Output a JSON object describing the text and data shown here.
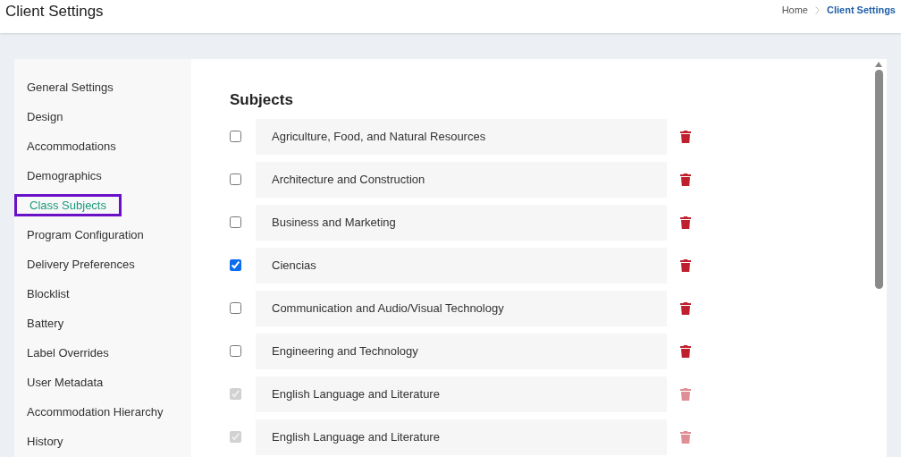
{
  "header": {
    "title": "Client Settings",
    "breadcrumb": [
      {
        "label": "Home",
        "selected": false
      },
      {
        "label": "Client Settings",
        "selected": true
      }
    ]
  },
  "sidebar": {
    "items": [
      {
        "label": "General Settings",
        "selected": false
      },
      {
        "label": "Design",
        "selected": false
      },
      {
        "label": "Accommodations",
        "selected": false
      },
      {
        "label": "Demographics",
        "selected": false
      },
      {
        "label": "Class Subjects",
        "selected": true
      },
      {
        "label": "Program Configuration",
        "selected": false
      },
      {
        "label": "Delivery Preferences",
        "selected": false
      },
      {
        "label": "Blocklist",
        "selected": false
      },
      {
        "label": "Battery",
        "selected": false
      },
      {
        "label": "Label Overrides",
        "selected": false
      },
      {
        "label": "User Metadata",
        "selected": false
      },
      {
        "label": "Accommodation Hierarchy",
        "selected": false
      },
      {
        "label": "History",
        "selected": false
      }
    ]
  },
  "section": {
    "title": "Subjects",
    "subjects": [
      {
        "name": "Agriculture, Food, and Natural Resources",
        "checked": false,
        "disabled": false
      },
      {
        "name": "Architecture and Construction",
        "checked": false,
        "disabled": false
      },
      {
        "name": "Business and Marketing",
        "checked": false,
        "disabled": false
      },
      {
        "name": "Ciencias",
        "checked": true,
        "disabled": false
      },
      {
        "name": "Communication and Audio/Visual Technology",
        "checked": false,
        "disabled": false
      },
      {
        "name": "Engineering and Technology",
        "checked": false,
        "disabled": false
      },
      {
        "name": "English Language and Literature",
        "checked": true,
        "disabled": true
      },
      {
        "name": "English Language and Literature",
        "checked": true,
        "disabled": true
      }
    ]
  }
}
